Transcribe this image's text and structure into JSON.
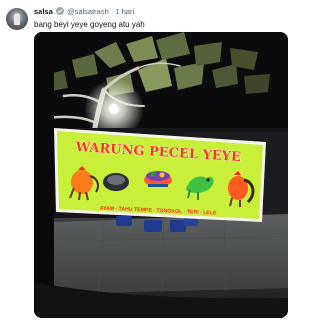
{
  "tweet": {
    "author_name": "salsa",
    "author_handle": "@salsatrash",
    "separator": "·",
    "time": "1 hari",
    "text": "bang beyi yeye goyeng atu yah",
    "verified_color": "#9ea6ad"
  },
  "photo": {
    "banner": {
      "title": "WARUNG PECEL YEYE",
      "menu_line": "AYAM · TAHU TEMPE · TONGKOL · TERI · LELE",
      "background_color": "#c8ef3a",
      "title_color": "#f23b1e",
      "menu_color": "#ff2f26"
    }
  }
}
